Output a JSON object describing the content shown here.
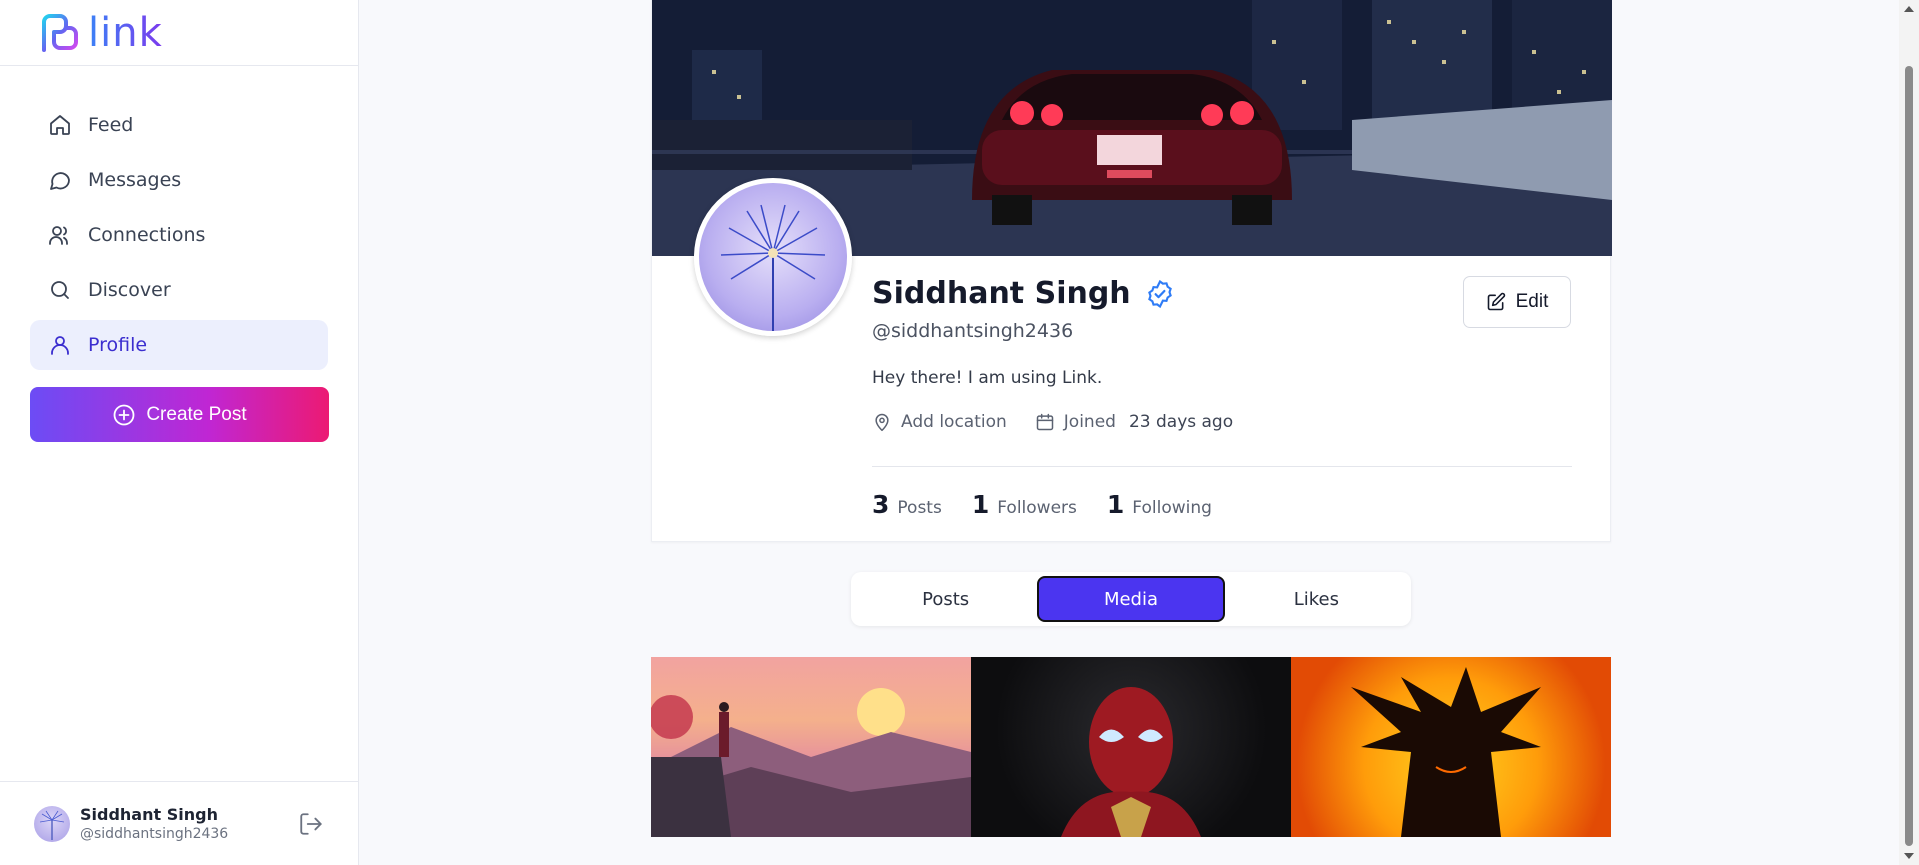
{
  "app": {
    "logo_text": "link"
  },
  "sidebar": {
    "items": [
      {
        "label": "Feed",
        "icon": "home-icon"
      },
      {
        "label": "Messages",
        "icon": "message-icon"
      },
      {
        "label": "Connections",
        "icon": "users-icon"
      },
      {
        "label": "Discover",
        "icon": "search-icon"
      },
      {
        "label": "Profile",
        "icon": "user-icon",
        "active": true
      }
    ],
    "create_post_label": "Create Post",
    "user": {
      "name": "Siddhant Singh",
      "handle": "@siddhantsingh2436"
    }
  },
  "profile": {
    "name": "Siddhant Singh",
    "handle": "@siddhantsingh2436",
    "bio": "Hey there! I am using Link.",
    "location_label": "Add location",
    "joined_label": "Joined",
    "joined_value": "23 days ago",
    "edit_label": "Edit",
    "stats": {
      "posts_count": "3",
      "posts_label": "Posts",
      "followers_count": "1",
      "followers_label": "Followers",
      "following_count": "1",
      "following_label": "Following"
    }
  },
  "tabs": [
    {
      "label": "Posts"
    },
    {
      "label": "Media",
      "active": true
    },
    {
      "label": "Likes"
    }
  ],
  "colors": {
    "accent": "#4b35f0",
    "verified": "#2f7cf6",
    "active_nav_bg": "#eceffd"
  }
}
